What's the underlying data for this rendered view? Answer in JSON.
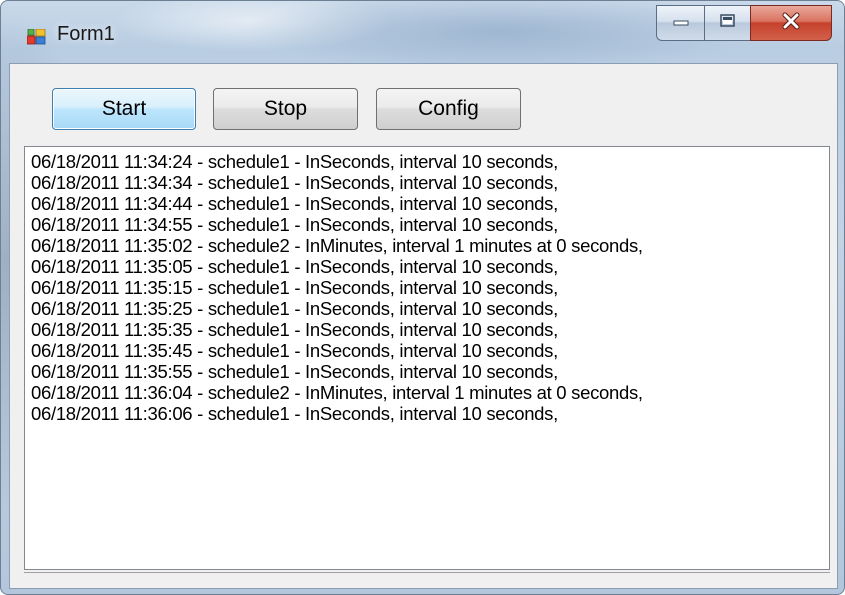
{
  "window": {
    "title": "Form1",
    "icon": "winforms-app-icon"
  },
  "caption_buttons": {
    "minimize_icon": "minimize-icon",
    "maximize_icon": "maximize-icon",
    "close_icon": "close-icon"
  },
  "toolbar": {
    "start_label": "Start",
    "stop_label": "Stop",
    "config_label": "Config"
  },
  "log": {
    "lines": [
      "06/18/2011 11:34:24 - schedule1 - InSeconds, interval 10 seconds,",
      "06/18/2011 11:34:34 - schedule1 - InSeconds, interval 10 seconds,",
      "06/18/2011 11:34:44 - schedule1 - InSeconds, interval 10 seconds,",
      "06/18/2011 11:34:55 - schedule1 - InSeconds, interval 10 seconds,",
      "06/18/2011 11:35:02 - schedule2 - InMinutes, interval 1 minutes at 0 seconds,",
      "06/18/2011 11:35:05 - schedule1 - InSeconds, interval 10 seconds,",
      "06/18/2011 11:35:15 - schedule1 - InSeconds, interval 10 seconds,",
      "06/18/2011 11:35:25 - schedule1 - InSeconds, interval 10 seconds,",
      "06/18/2011 11:35:35 - schedule1 - InSeconds, interval 10 seconds,",
      "06/18/2011 11:35:45 - schedule1 - InSeconds, interval 10 seconds,",
      "06/18/2011 11:35:55 - schedule1 - InSeconds, interval 10 seconds,",
      "06/18/2011 11:36:04 - schedule2 - InMinutes, interval 1 minutes at 0 seconds,",
      "06/18/2011 11:36:06 - schedule1 - InSeconds, interval 10 seconds,"
    ]
  },
  "colors": {
    "frame": "#b9cde2",
    "client_background": "#f0f0f0",
    "close_button": "#c5412b",
    "focused_button_border": "#3c7fb1"
  }
}
